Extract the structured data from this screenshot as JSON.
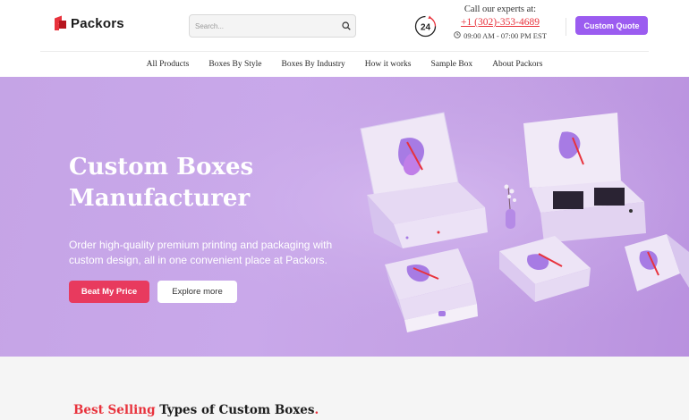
{
  "brand": {
    "name": "Packors"
  },
  "search": {
    "placeholder": "Search..."
  },
  "contact": {
    "label": "Call our experts at:",
    "phone": "+1 (302)-353-4689",
    "hours": "09:00 AM - 07:00 PM EST",
    "badge": "24"
  },
  "header": {
    "quote_label": "Custom Quote"
  },
  "nav": {
    "items": [
      "All Products",
      "Boxes By Style",
      "Boxes By Industry",
      "How it works",
      "Sample Box",
      "About Packors"
    ]
  },
  "hero": {
    "title_line1": "Custom Boxes",
    "title_line2": "Manufacturer",
    "description": "Order high-quality premium printing and packaging with custom design, all in one convenient place at Packors.",
    "primary_cta": "Beat My Price",
    "secondary_cta": "Explore more"
  },
  "section": {
    "title_highlight": "Best Selling",
    "title_rest": " Types of Custom Boxes",
    "title_dot": "."
  },
  "colors": {
    "accent_red": "#e8323c",
    "accent_purple": "#9b5cf0",
    "cta_pink": "#e83a5e",
    "hero_bg": "#c6a5e7"
  },
  "icons": {
    "search": "search-icon",
    "support": "support-24-icon",
    "clock": "clock-icon"
  }
}
